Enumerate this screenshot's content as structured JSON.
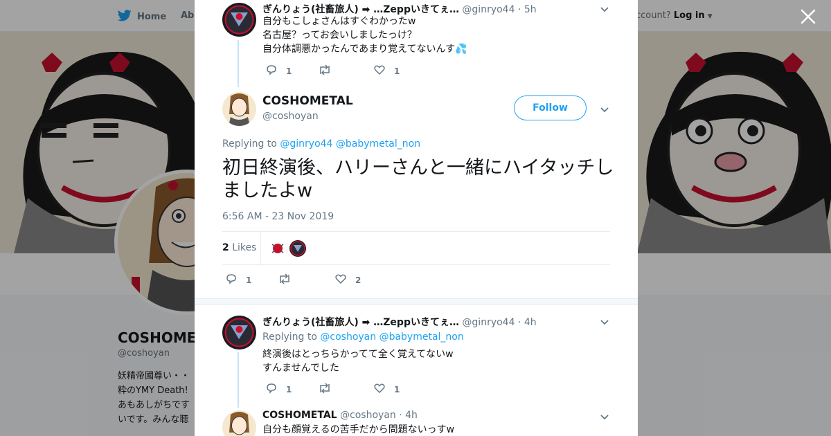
{
  "topbar": {
    "home_label": "Home",
    "about_label": "Abo",
    "account_prefix": "ccount?",
    "login_label": "Log in"
  },
  "profile": {
    "name": "COSHOMET",
    "handle": "@coshoyan",
    "bio": "妖精帝國尊い・・\n粋のYMY Death! \nあもあしがちです\nいです。みんな聴"
  },
  "thread": {
    "tweet1": {
      "name": "ぎんりょう(社畜旅人) ➡ …Zeppいきてぇ…",
      "handle": "@ginryo44",
      "time": "· 5h",
      "text": [
        "自分もこしょさんはすぐわかったw",
        "名古屋？ってお会いしましたっけ？",
        "自分体調悪かったんであまり覚えてないんす💦"
      ],
      "replies": "1",
      "retweets": "",
      "likes": "1"
    },
    "main": {
      "name": "COSHOMETAL",
      "handle": "@coshoyan",
      "follow_label": "Follow",
      "replying_prefix": "Replying to",
      "replying_users": [
        "@ginryo44",
        "@babymetal_non"
      ],
      "text": "初日終演後、ハリーさんと一緒にハイタッチしましたよw",
      "timestamp": "6:56 AM - 23 Nov 2019",
      "likes_count": "2",
      "likes_label": "Likes",
      "replies": "1",
      "retweets": "",
      "likes": "2"
    },
    "tweet3": {
      "name": "ぎんりょう(社畜旅人) ➡ …Zeppいきてぇ…",
      "handle": "@ginryo44",
      "time": "· 4h",
      "replying_prefix": "Replying to",
      "replying_users": [
        "@coshoyan",
        "@babymetal_non"
      ],
      "text": [
        "終演後はとっちらかってて全く覚えてないw",
        "すんませんでした"
      ],
      "replies": "1",
      "retweets": "",
      "likes": "1"
    },
    "tweet4": {
      "name": "COSHOMETAL",
      "handle": "@coshoyan",
      "time": "· 4h",
      "text": "自分も顔覚えるの苦手だから問題ないっすw"
    }
  },
  "colors": {
    "accent": "#1da1f2",
    "thread_line": "#c4e4f6",
    "secondary_text": "#657786"
  }
}
